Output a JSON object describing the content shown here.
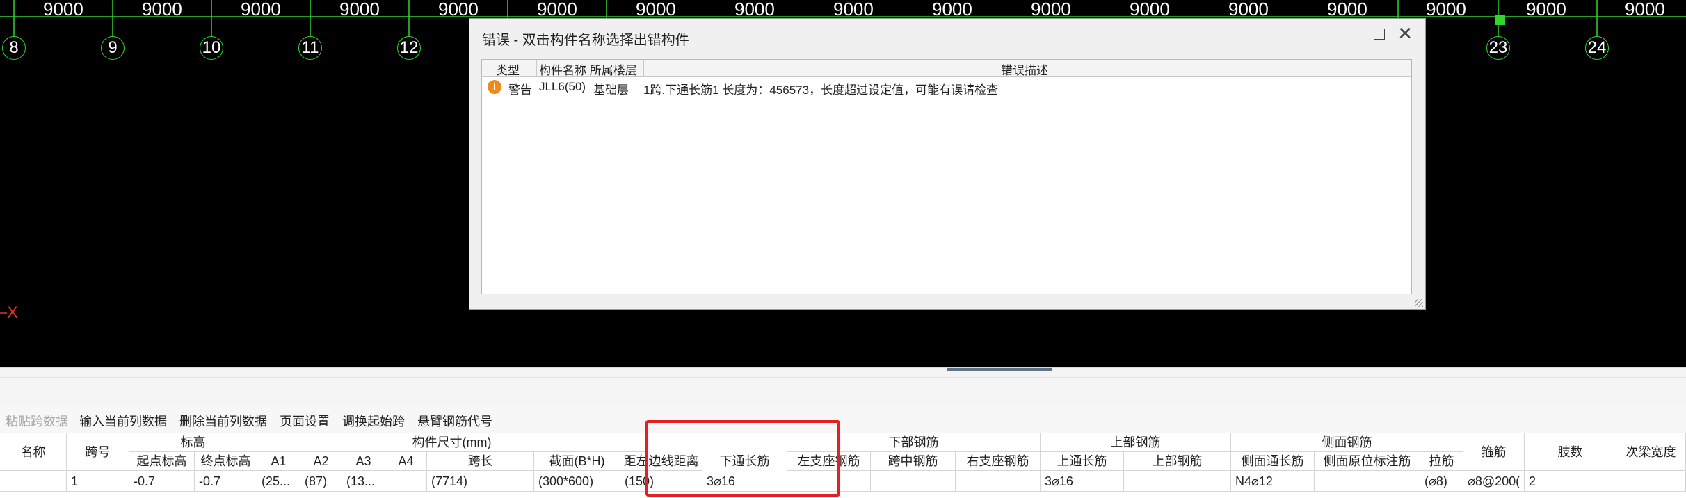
{
  "canvas": {
    "axis_dimensions": [
      "9000",
      "9000",
      "9000",
      "9000",
      "9000",
      "9000",
      "9000",
      "9000",
      "9000",
      "9000",
      "9000",
      "9000",
      "9000",
      "9000",
      "9000",
      "9000",
      "9000"
    ],
    "axis_numbers": [
      "8",
      "9",
      "10",
      "11",
      "12",
      "23",
      "24"
    ],
    "x_axis_label": "X",
    "colors": {
      "background": "#000000",
      "grid": "#2fd62f",
      "axis_text": "#ffffff",
      "x_axis": "#e53030"
    }
  },
  "dialog": {
    "title": "错误 - 双击构件名称选择出错构件",
    "columns": {
      "type": "类型",
      "name_floor": "构件名称 所属楼层",
      "description": "错误描述"
    },
    "rows": [
      {
        "icon": "warning-icon",
        "type": "警告",
        "name": "JLL6(50)",
        "floor": "基础层",
        "description": "1跨.下通长筋1 长度为：456573，长度超过设定值，可能有误请检查"
      }
    ]
  },
  "toolbar": {
    "items": [
      {
        "label": "粘贴跨数据",
        "enabled": false
      },
      {
        "label": "输入当前列数据",
        "enabled": true
      },
      {
        "label": "删除当前列数据",
        "enabled": true
      },
      {
        "label": "页面设置",
        "enabled": true
      },
      {
        "label": "调换起始跨",
        "enabled": true
      },
      {
        "label": "悬臂钢筋代号",
        "enabled": true
      }
    ]
  },
  "grid": {
    "group_headers": {
      "elevation": "标高",
      "dimensions": "构件尺寸(mm)",
      "bottom_rebar": "下部钢筋",
      "top_rebar": "上部钢筋",
      "side_rebar": "侧面钢筋"
    },
    "headers": {
      "name": "名称",
      "span": "跨号",
      "start_elev": "起点标高",
      "end_elev": "终点标高",
      "a1": "A1",
      "a2": "A2",
      "a3": "A3",
      "a4": "A4",
      "span_length": "跨长",
      "section": "截面(B*H)",
      "edge_dist": "距左边线距离",
      "bottom_long": "下通长筋",
      "left_support": "左支座钢筋",
      "mid_span": "跨中钢筋",
      "right_support": "右支座钢筋",
      "top_long": "上通长筋",
      "top_rebar": "上部钢筋",
      "side_long": "侧面通长筋",
      "side_local": "侧面原位标注筋",
      "tie": "拉筋",
      "stirrup": "箍筋",
      "legs": "肢数",
      "secondary_width": "次梁宽度"
    },
    "row": {
      "name": "",
      "span": "1",
      "start_elev": "-0.7",
      "end_elev": "-0.7",
      "a1": "(25...",
      "a2": "(87)",
      "a3": "(13...",
      "a4": "",
      "span_length": "(7714)",
      "section": "(300*600)",
      "edge_dist": "(150)",
      "bottom_long": "3⌀16",
      "left_support": "",
      "mid_span": "",
      "right_support": "",
      "top_long": "3⌀16",
      "top_rebar": "",
      "side_long": "N4⌀12",
      "side_local": "",
      "tie": "(⌀8)",
      "stirrup": "⌀8@200(",
      "legs": "2",
      "secondary_width": ""
    }
  }
}
